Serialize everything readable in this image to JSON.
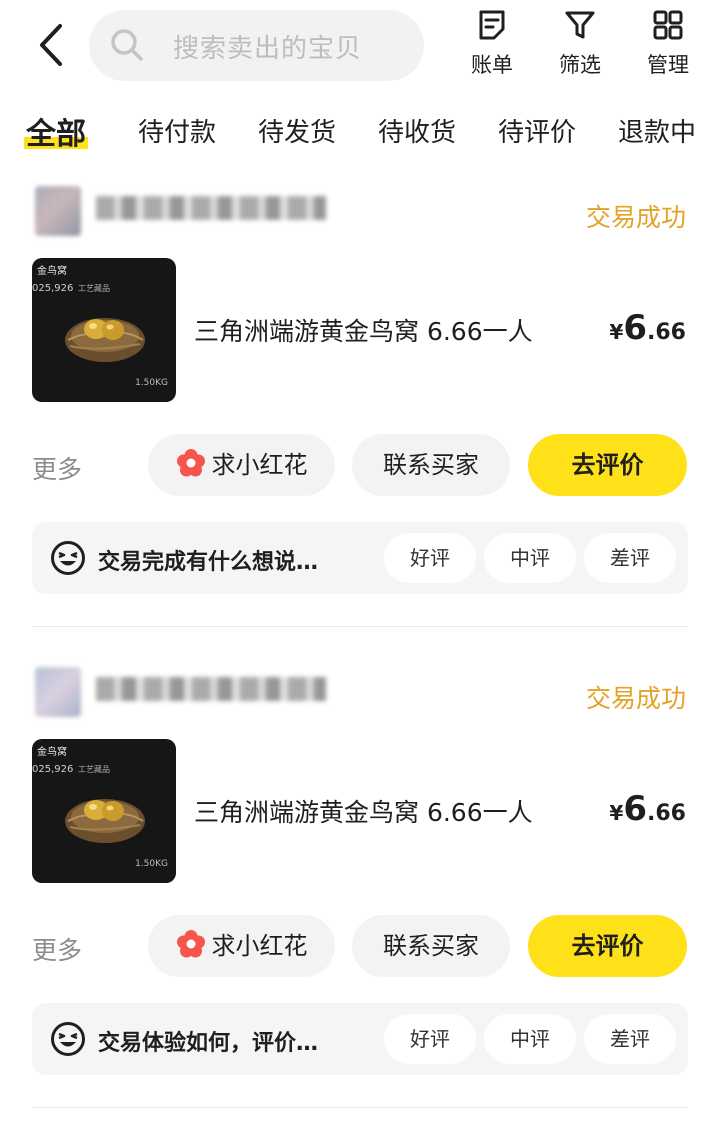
{
  "search": {
    "placeholder": "搜索卖出的宝贝"
  },
  "tools": [
    {
      "label": "账单",
      "icon": "bill-icon"
    },
    {
      "label": "筛选",
      "icon": "filter-icon"
    },
    {
      "label": "管理",
      "icon": "grid-icon"
    }
  ],
  "tabs": [
    "全部",
    "待付款",
    "待发货",
    "待收货",
    "待评价",
    "退款中"
  ],
  "orders": [
    {
      "status": "交易成功",
      "thumb": {
        "title": "金鸟窝",
        "number": "025,926",
        "badge": "工艺藏品",
        "weight": "1.50KG"
      },
      "title": "三角洲端游黄金鸟窝 6.66一人",
      "price": {
        "currency": "¥",
        "integer": "6",
        "decimal": ".66"
      },
      "more": "更多",
      "buttons": {
        "flower": "求小红花",
        "contact": "联系买家",
        "rate": "去评价"
      },
      "review_prompt": "交易完成有什么想说…",
      "chips": [
        "好评",
        "中评",
        "差评"
      ]
    },
    {
      "status": "交易成功",
      "thumb": {
        "title": "金鸟窝",
        "number": "025,926",
        "badge": "工艺藏品",
        "weight": "1.50KG"
      },
      "title": "三角洲端游黄金鸟窝 6.66一人",
      "price": {
        "currency": "¥",
        "integer": "6",
        "decimal": ".66"
      },
      "more": "更多",
      "buttons": {
        "flower": "求小红花",
        "contact": "联系买家",
        "rate": "去评价"
      },
      "review_prompt": "交易体验如何，评价…",
      "chips": [
        "好评",
        "中评",
        "差评"
      ]
    }
  ],
  "colors": {
    "accent": "#ffe11a",
    "status": "#e4a227",
    "flower": "#f5554a"
  }
}
